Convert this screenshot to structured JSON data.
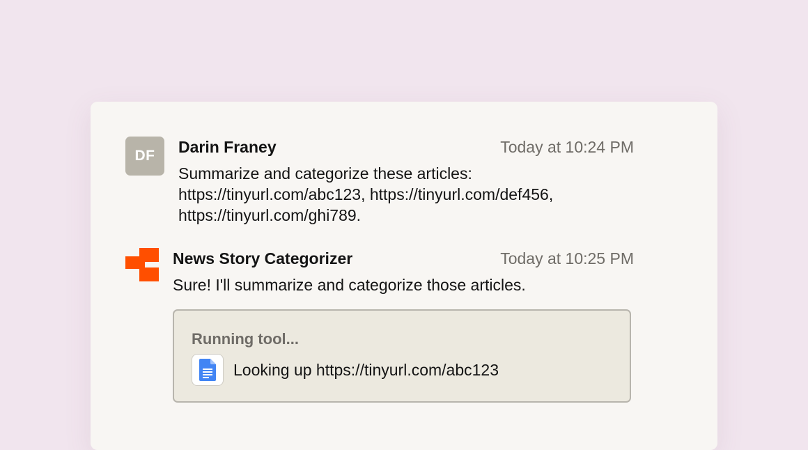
{
  "colors": {
    "page_background": "#f1e5ee",
    "card_background": "#f8f6f3",
    "avatar_background": "#b8b4a9",
    "bot_logo": "#ff4f00",
    "tool_box_background": "#ece9df",
    "doc_icon": "#4285f4"
  },
  "messages": {
    "user": {
      "avatar_initials": "DF",
      "author": "Darin Franey",
      "timestamp": "Today at 10:24 PM",
      "text": "Summarize and categorize these articles: https://tinyurl.com/abc123, https://tinyurl.com/def456, https://tinyurl.com/ghi789."
    },
    "bot": {
      "avatar_icon": "app-logo-icon",
      "author": "News Story Categorizer",
      "timestamp": "Today at 10:25 PM",
      "text": "Sure! I'll summarize and categorize those articles.",
      "tool": {
        "status": "Running tool...",
        "icon": "google-docs-icon",
        "action": "Looking up https://tinyurl.com/abc123"
      }
    }
  }
}
